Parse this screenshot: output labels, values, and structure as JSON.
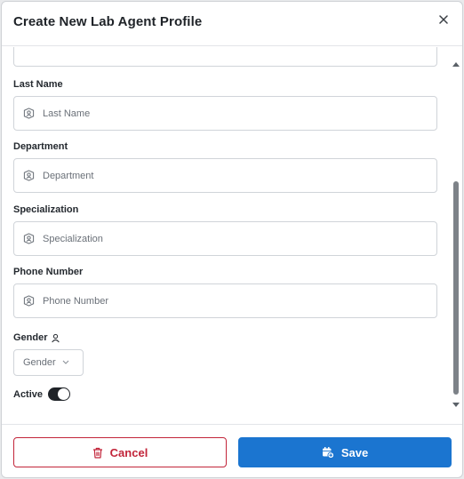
{
  "modal": {
    "title": "Create New Lab Agent Profile"
  },
  "fields": {
    "last_name": {
      "label": "Last Name",
      "placeholder": "Last Name",
      "value": ""
    },
    "department": {
      "label": "Department",
      "placeholder": "Department",
      "value": ""
    },
    "specialization": {
      "label": "Specialization",
      "placeholder": "Specialization",
      "value": ""
    },
    "phone_number": {
      "label": "Phone Number",
      "placeholder": "Phone Number",
      "value": ""
    }
  },
  "gender": {
    "label": "Gender",
    "selected": "Gender"
  },
  "active": {
    "label": "Active",
    "on": true
  },
  "footer": {
    "cancel_label": "Cancel",
    "save_label": "Save"
  },
  "colors": {
    "cancel": "#c2253a",
    "save": "#1b75d0",
    "toggle_on": "#1f2328"
  },
  "icons": {
    "close": "close-icon",
    "field": "id-badge-icon",
    "gender": "user-icon",
    "select": "chevron-down-icon",
    "cancel": "trash-icon",
    "save": "calendar-add-icon"
  }
}
